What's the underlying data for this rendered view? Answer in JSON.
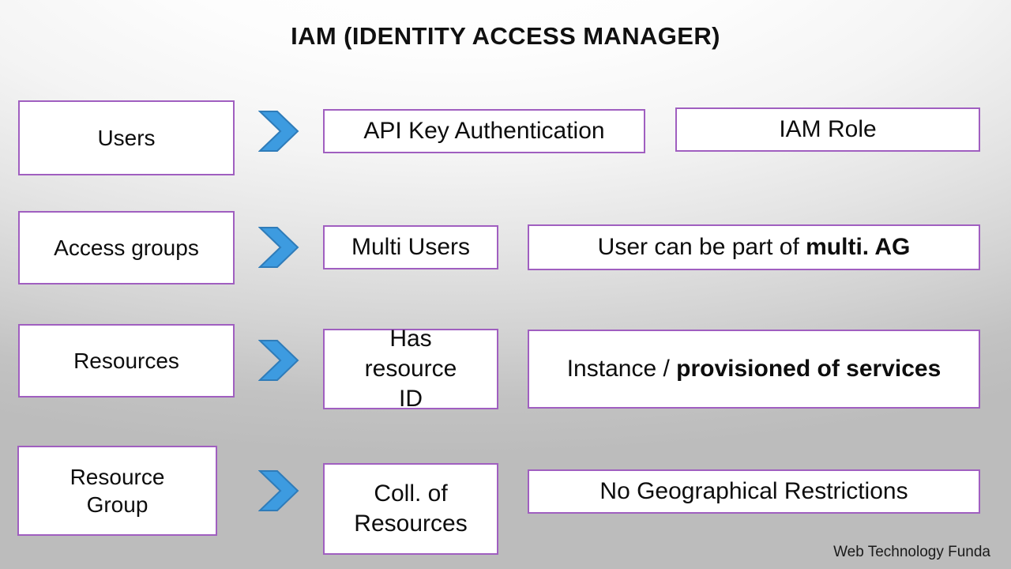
{
  "slide": {
    "title": "IAM (IDENTITY ACCESS MANAGER)",
    "footer": "Web Technology Funda",
    "colors": {
      "box_border": "#a05fc0",
      "box_fill": "#ffffff",
      "arrow_fill": "#3d9be0",
      "arrow_stroke": "#2e7cb8",
      "text": "#0d0d0d",
      "background_light": "#ffffff",
      "background_dark": "#bcbcbc"
    }
  },
  "rows": [
    {
      "id": "users",
      "concept": "Users",
      "arrow": "chevron-right-icon",
      "detail": "API Key Authentication",
      "note_plain": "IAM Role",
      "note_bold": ""
    },
    {
      "id": "access-groups",
      "concept": "Access groups",
      "arrow": "chevron-right-icon",
      "detail": "Multi Users",
      "note_plain": "User can be part of ",
      "note_bold": "multi. AG"
    },
    {
      "id": "resources",
      "concept": "Resources",
      "arrow": "chevron-right-icon",
      "detail": "Has resource ID",
      "note_plain": "Instance / ",
      "note_bold": "provisioned of services"
    },
    {
      "id": "resource-group",
      "concept": "Resource Group",
      "arrow": "chevron-right-icon",
      "detail": "Coll. of Resources",
      "note_plain": "No Geographical Restrictions",
      "note_bold": ""
    }
  ]
}
